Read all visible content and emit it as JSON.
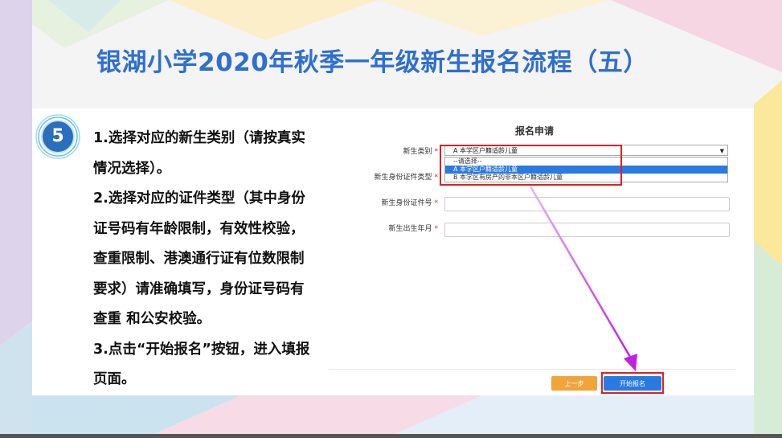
{
  "slide": {
    "title": "银湖小学2020年秋季一年级新生报名流程（五）",
    "step_number": "5",
    "instructions": [
      "1.选择对应的新生类别（请按真实情况选择）。",
      "2.选择对应的证件类型（其中身份证号码有年龄限制，有效性校验，查重限制、港澳通行证有位数限制要求）请准确填写，身份证号码有查重 和公安校验。",
      "3.点击“开始报名”按钮，进入填报页面。"
    ]
  },
  "form": {
    "title": "报名申请",
    "required_mark": "*",
    "fields": {
      "category_label": "新生类别",
      "id_type_label": "新生身份证件类型",
      "id_number_label": "新生身份证件号",
      "birth_label": "新生出生年月"
    },
    "category_select": {
      "value": "A 本学区户籍适龄儿童",
      "arrow": "▼",
      "options": [
        "--请选择--",
        "A 本学区户籍适龄儿童",
        "B 本学区有房产的非本区户籍适龄儿童"
      ]
    },
    "buttons": {
      "prev": "上一步",
      "start": "开始报名"
    }
  },
  "colors": {
    "title": "#2f6fcf",
    "highlight": "#e02020",
    "arrow": "#d23cf0",
    "prev_button": "#f0a43a",
    "start_button": "#2a7ae2"
  }
}
